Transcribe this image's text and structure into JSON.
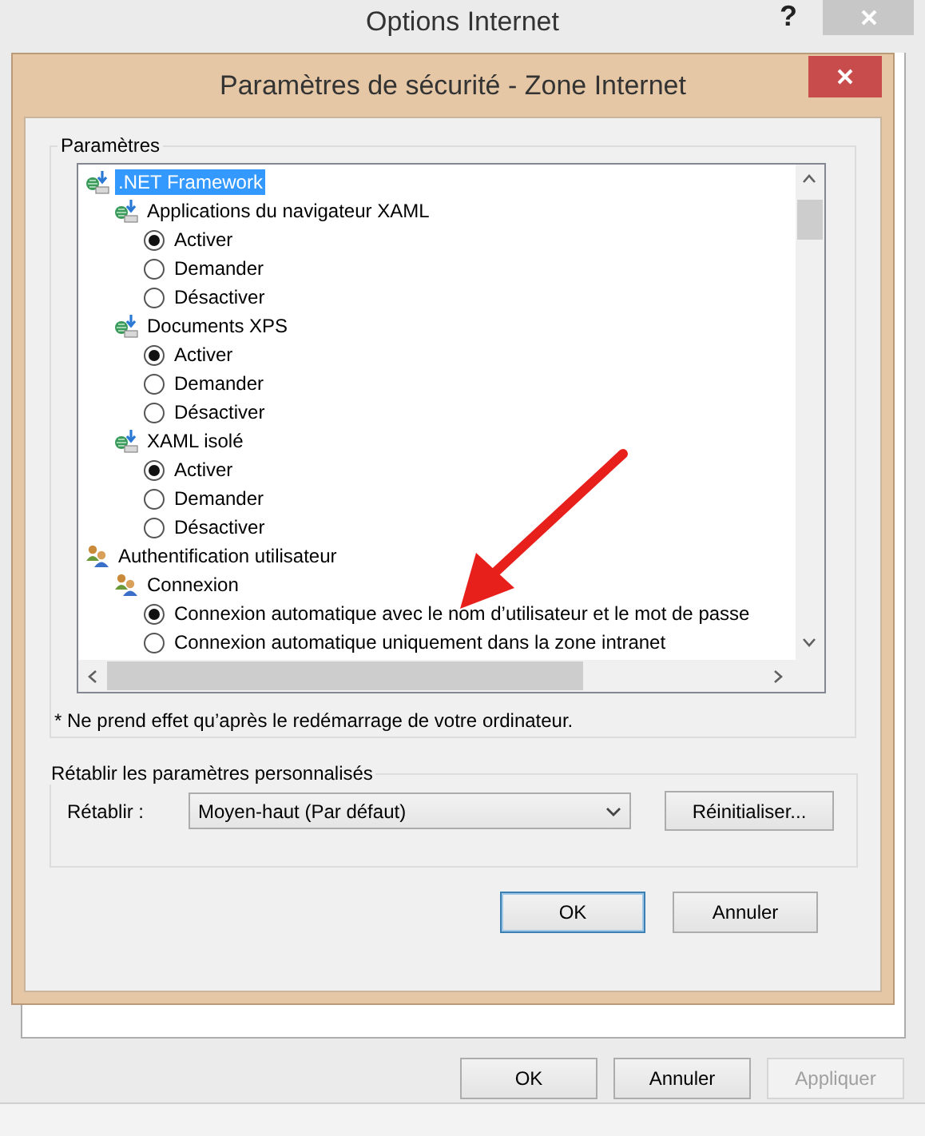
{
  "window": {
    "title": "Options Internet",
    "help": "?",
    "buttons": [
      {
        "label": "OK",
        "disabled": false
      },
      {
        "label": "Annuler",
        "disabled": false
      },
      {
        "label": "Appliquer",
        "disabled": true
      }
    ]
  },
  "dialog": {
    "title": "Paramètres de sécurité - Zone Internet",
    "settings_group": {
      "label": "Paramètres",
      "tree": [
        {
          "kind": "net",
          "label": ".NET Framework",
          "selected": true,
          "children": [
            {
              "kind": "net",
              "label": "Applications du navigateur XAML",
              "selected": false,
              "children": [
                {
                  "kind": "radio",
                  "label": "Activer",
                  "checked": true
                },
                {
                  "kind": "radio",
                  "label": "Demander",
                  "checked": false
                },
                {
                  "kind": "radio",
                  "label": "Désactiver",
                  "checked": false
                }
              ]
            },
            {
              "kind": "net",
              "label": "Documents XPS",
              "selected": false,
              "children": [
                {
                  "kind": "radio",
                  "label": "Activer",
                  "checked": true
                },
                {
                  "kind": "radio",
                  "label": "Demander",
                  "checked": false
                },
                {
                  "kind": "radio",
                  "label": "Désactiver",
                  "checked": false
                }
              ]
            },
            {
              "kind": "net",
              "label": "XAML isolé",
              "selected": false,
              "children": [
                {
                  "kind": "radio",
                  "label": "Activer",
                  "checked": true
                },
                {
                  "kind": "radio",
                  "label": "Demander",
                  "checked": false
                },
                {
                  "kind": "radio",
                  "label": "Désactiver",
                  "checked": false
                }
              ]
            }
          ]
        },
        {
          "kind": "users",
          "label": "Authentification utilisateur",
          "selected": false,
          "children": [
            {
              "kind": "users",
              "label": "Connexion",
              "selected": false,
              "children": [
                {
                  "kind": "radio",
                  "label": "Connexion automatique avec le nom d’utilisateur et le mot de passe",
                  "checked": true
                },
                {
                  "kind": "radio",
                  "label": "Connexion automatique uniquement dans la zone intranet",
                  "checked": false
                }
              ]
            }
          ]
        }
      ],
      "note": "* Ne prend effet qu’après le redémarrage de votre ordinateur."
    },
    "reset_group": {
      "label": "Rétablir les paramètres personnalisés",
      "reset_label": "Rétablir :",
      "reset_value": "Moyen-haut (Par défaut)",
      "reset_button": "Réinitialiser..."
    },
    "buttons": [
      {
        "label": "OK",
        "default": true
      },
      {
        "label": "Annuler",
        "default": false
      }
    ]
  }
}
